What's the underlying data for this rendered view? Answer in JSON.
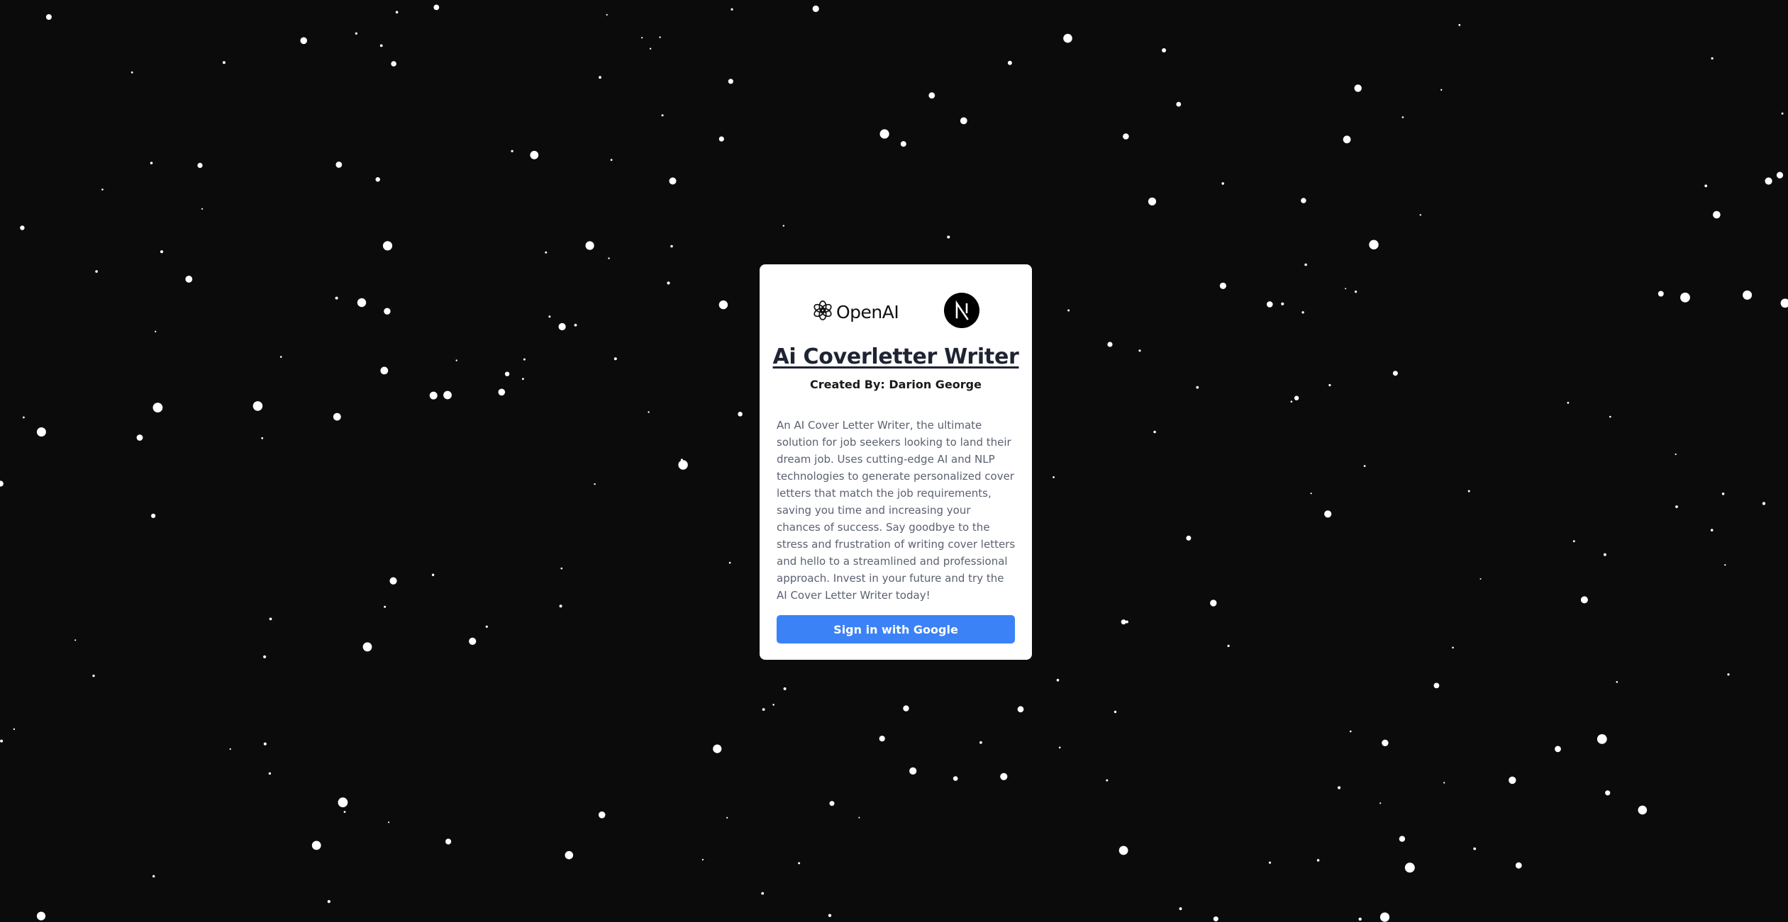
{
  "background": {
    "color": "#0b0b0c",
    "star_color": "#ffffff"
  },
  "card": {
    "logos": {
      "openai": {
        "icon": "openai-icon",
        "wordmark": "OpenAI"
      },
      "nextjs": {
        "icon": "nextjs-icon"
      }
    },
    "title": "Ai Coverletter Writer",
    "author": "Created By: Darion George",
    "description": "An AI Cover Letter Writer, the ultimate solution for job seekers looking to land their dream job. Uses cutting-edge AI and NLP technologies to generate personalized cover letters that match the job requirements, saving you time and increasing your chances of success. Say goodbye to the stress and frustration of writing cover letters and hello to a streamlined and professional approach. Invest in your future and try the AI Cover Letter Writer today!",
    "signin_label": "Sign in with Google",
    "accent_color": "#3b82f6"
  }
}
